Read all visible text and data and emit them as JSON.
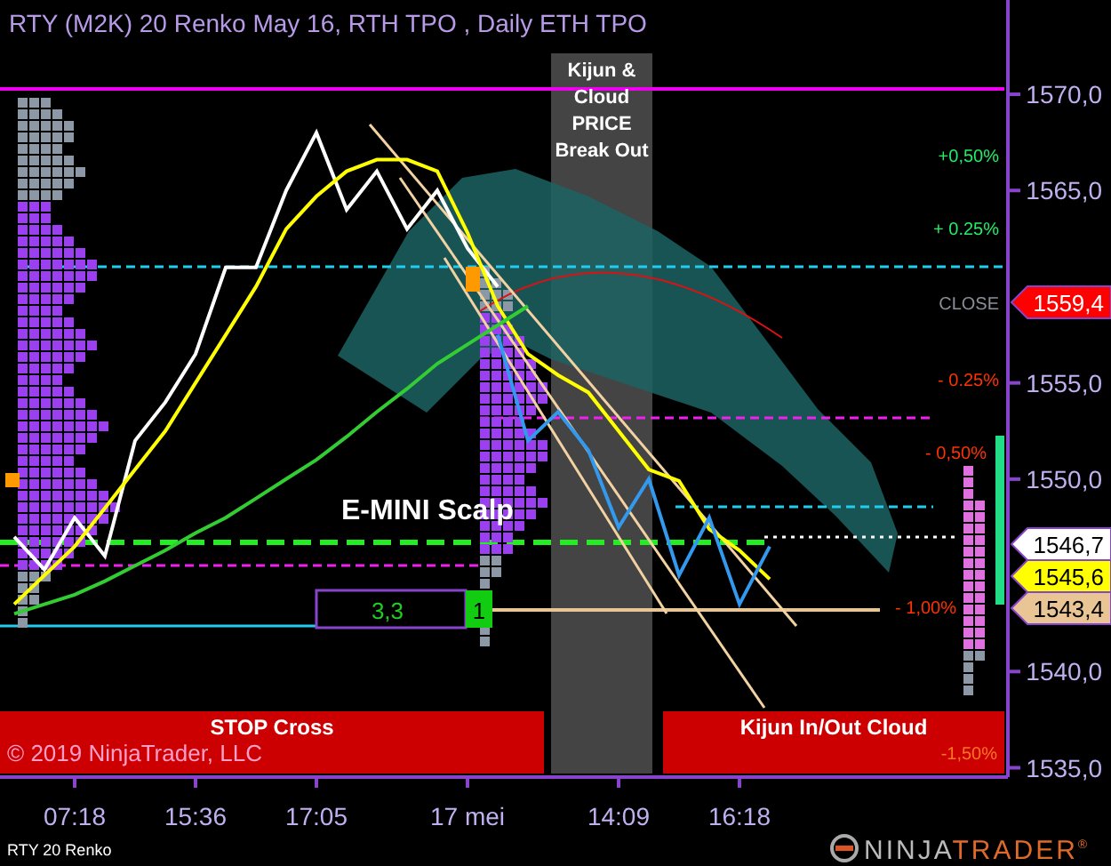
{
  "title": "RTY (M2K) 20 Renko  May 16, RTH TPO , Daily ETH TPO",
  "chart": {
    "chart_data": {
      "type": "line",
      "categories": [
        null,
        null,
        "07:18",
        null,
        null,
        null,
        "15:36",
        null,
        null,
        null,
        "17:05",
        null,
        null,
        null,
        null,
        "17 mei",
        null,
        null,
        null,
        null,
        "14:09",
        null,
        null,
        null,
        "16:18",
        null
      ],
      "series": [
        {
          "color": "#ffffff",
          "values": [
            1547,
            1545.3,
            1548,
            1546,
            1552,
            1554,
            1556.5,
            1561,
            1561,
            1565,
            1568,
            1564,
            1566,
            1563,
            1565,
            1562,
            1560,
            null,
            null,
            null,
            null,
            null,
            null,
            null,
            null,
            null
          ]
        },
        {
          "color": "#ffff00",
          "values": [
            1543.5,
            1545,
            1546.5,
            1548.5,
            1550.5,
            1552.5,
            1555,
            1557.5,
            1560,
            1563,
            1564.7,
            1566,
            1566.6,
            1566.6,
            1566,
            1562.8,
            1559,
            1556.5,
            1555.4,
            1554.5,
            1552.5,
            1550.5,
            1549.9,
            1547.4,
            1546.3,
            1544.8
          ]
        },
        {
          "color": "#3399ee",
          "values": [
            null,
            null,
            null,
            null,
            null,
            null,
            null,
            null,
            null,
            null,
            null,
            null,
            null,
            null,
            null,
            null,
            1557.5,
            1552,
            1553.5,
            1551.5,
            1547.5,
            1550,
            1545,
            1548,
            1543.5,
            1546.5
          ]
        },
        {
          "color": "#33cc33",
          "values": [
            1543,
            1543.5,
            1544,
            1544.7,
            1545.5,
            1546.3,
            1547.2,
            1548,
            1549,
            1550,
            1551,
            1552.2,
            1553.5,
            1554.7,
            1556,
            1557,
            1558,
            1559,
            null,
            null,
            null,
            null,
            null,
            null,
            null,
            null
          ]
        }
      ],
      "ylim": [
        1534.7,
        1574.9
      ],
      "yticks": [
        {
          "value": 1535,
          "label": "1535,0"
        },
        {
          "value": 1540,
          "label": "1540,0"
        },
        {
          "value": 1550,
          "label": "1550,0"
        },
        {
          "value": 1555,
          "label": "1555,0"
        },
        {
          "value": 1565,
          "label": "1565,0"
        },
        {
          "value": 1570,
          "label": "1570,0"
        }
      ]
    }
  },
  "percent_labels": [
    {
      "text": "+0,50%",
      "kind": "up"
    },
    {
      "text": "+ 0.25%",
      "kind": "up"
    },
    {
      "text": "CLOSE",
      "kind": "close"
    },
    {
      "text": "- 0.25%",
      "kind": "down"
    },
    {
      "text": "- 0,50%",
      "kind": "down"
    },
    {
      "text": "- 1,00%",
      "kind": "down"
    }
  ],
  "price_tags": [
    {
      "text": "1559,4",
      "kind": "close"
    },
    {
      "text": "1546,7",
      "kind": "white"
    },
    {
      "text": "1545,6",
      "kind": "yellow"
    },
    {
      "text": "1543,4",
      "kind": "tan"
    }
  ],
  "signal_box": "Kijun & Cloud PRICE Break Out",
  "scalp_label": "E-MINI Scalp",
  "stats": {
    "value": "3,3",
    "count": "1"
  },
  "alert_bars": [
    {
      "text": "STOP Cross"
    },
    {
      "text": "Kijun In/Out Cloud",
      "note": "-1,50%"
    }
  ],
  "copyright": "© 2019 NinjaTrader, LLC",
  "instrument": "RTY 20 Renko",
  "logo_parts": [
    "NINJA",
    "TRADER",
    "®"
  ]
}
